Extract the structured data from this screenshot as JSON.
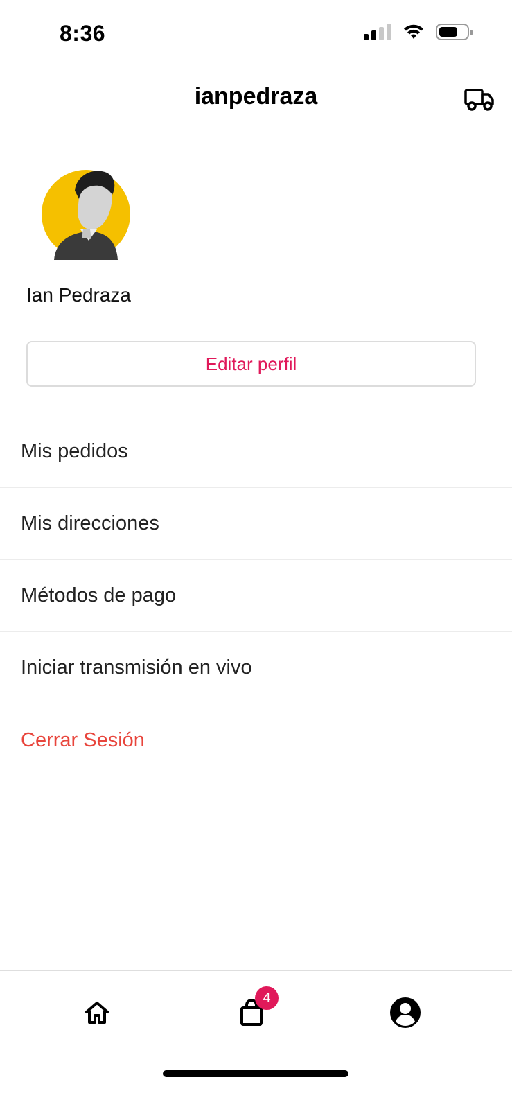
{
  "status_bar": {
    "time": "8:36",
    "icons": [
      "cellular-signal-icon",
      "wifi-icon",
      "battery-icon"
    ]
  },
  "header": {
    "title": "ianpedraza",
    "right_icon": "truck-icon"
  },
  "profile": {
    "name": "Ian Pedraza",
    "avatar_bg_color": "#f5c000",
    "edit_label": "Editar perfil"
  },
  "menu": {
    "items": [
      {
        "label": "Mis pedidos"
      },
      {
        "label": "Mis direcciones"
      },
      {
        "label": "Métodos de pago"
      },
      {
        "label": "Iniciar transmisión en vivo"
      },
      {
        "label": "Cerrar Sesión"
      }
    ]
  },
  "tab_bar": {
    "tabs": [
      {
        "icon": "home-icon"
      },
      {
        "icon": "shopping-bag-icon",
        "badge": "4"
      },
      {
        "icon": "account-circle-icon"
      }
    ]
  },
  "colors": {
    "accent": "#e0195a",
    "logout": "#e8453c",
    "divider": "#ececec"
  }
}
